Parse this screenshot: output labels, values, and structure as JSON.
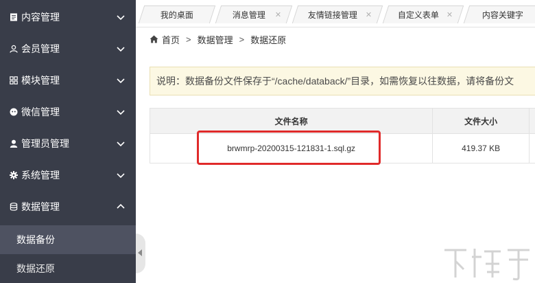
{
  "sidebar": {
    "items": [
      {
        "label": "内容管理",
        "icon": "document-icon"
      },
      {
        "label": "会员管理",
        "icon": "user-outline-icon"
      },
      {
        "label": "模块管理",
        "icon": "grid-icon"
      },
      {
        "label": "微信管理",
        "icon": "wechat-icon"
      },
      {
        "label": "管理员管理",
        "icon": "user-icon"
      },
      {
        "label": "系统管理",
        "icon": "gear-icon"
      },
      {
        "label": "数据管理",
        "icon": "database-icon"
      }
    ],
    "subitems": {
      "backup": "数据备份",
      "restore": "数据还原"
    }
  },
  "tabs": [
    {
      "label": "我的桌面"
    },
    {
      "label": "消息管理"
    },
    {
      "label": "友情链接管理"
    },
    {
      "label": "自定义表单"
    },
    {
      "label": "内容关键字"
    }
  ],
  "breadcrumb": {
    "home": "首页",
    "sep": ">",
    "level1": "数据管理",
    "level2": "数据还原"
  },
  "notice": {
    "text": "说明：数据备份文件保存于“/cache/databack/”目录，如需恢复以往数据，请将备份文"
  },
  "table": {
    "headers": [
      "文件名称",
      "文件大小"
    ],
    "rows": [
      {
        "name": "brwmrp-20200315-121831-1.sql.gz",
        "size": "419.37 KB"
      }
    ]
  },
  "colors": {
    "sidebar_bg": "#393d49",
    "sidebar_active": "#4e5261",
    "notice_bg": "#fcf8e3",
    "highlight": "#e02a2a"
  }
}
